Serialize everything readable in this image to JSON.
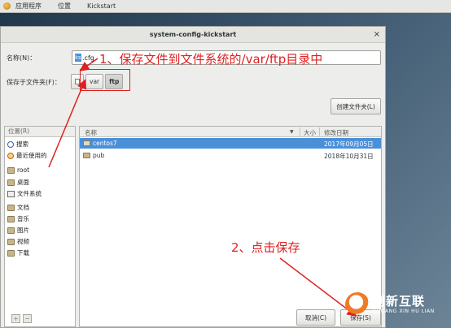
{
  "top_panel": {
    "menus": [
      "应用程序",
      "位置",
      "Kickstart"
    ]
  },
  "window": {
    "title": "system-config-kickstart",
    "close_glyph": "×"
  },
  "form": {
    "name_label": "名称(N)：",
    "name_value_selected": "ks",
    "name_value_rest": ".cfg",
    "save_in_label": "保存于文件夹(F)：",
    "path": [
      "var",
      "ftp"
    ],
    "create_folder_label": "创建文件夹(L)"
  },
  "places": {
    "header": "位置(R)",
    "items": [
      {
        "label": "搜索",
        "icon": "search-icon"
      },
      {
        "label": "最近使用的",
        "icon": "recent-icon"
      },
      {
        "label": "root",
        "icon": "folder-icon"
      },
      {
        "label": "桌面",
        "icon": "folder-icon"
      },
      {
        "label": "文件系统",
        "icon": "filesystem-icon"
      },
      {
        "label": "文档",
        "icon": "folder-icon"
      },
      {
        "label": "音乐",
        "icon": "folder-icon"
      },
      {
        "label": "图片",
        "icon": "folder-icon"
      },
      {
        "label": "视频",
        "icon": "folder-icon"
      },
      {
        "label": "下载",
        "icon": "folder-icon"
      }
    ],
    "add_glyph": "+",
    "remove_glyph": "−"
  },
  "files": {
    "columns": {
      "name": "名称",
      "size": "大小",
      "modified": "修改日期"
    },
    "sort_glyph": "▼",
    "rows": [
      {
        "name": "centos7",
        "modified": "2017年09月05日",
        "selected": true
      },
      {
        "name": "pub",
        "modified": "2018年10月31日",
        "selected": false
      }
    ]
  },
  "buttons": {
    "cancel": "取消(C)",
    "save": "保存(S)"
  },
  "annotations": {
    "step1": "1、保存文件到文件系统的/var/ftp目录中",
    "step2": "2、点击保存",
    "color": "#e02020"
  },
  "watermark": {
    "cn": "创新互联",
    "en": "CHUANG XIN HU LIAN"
  }
}
